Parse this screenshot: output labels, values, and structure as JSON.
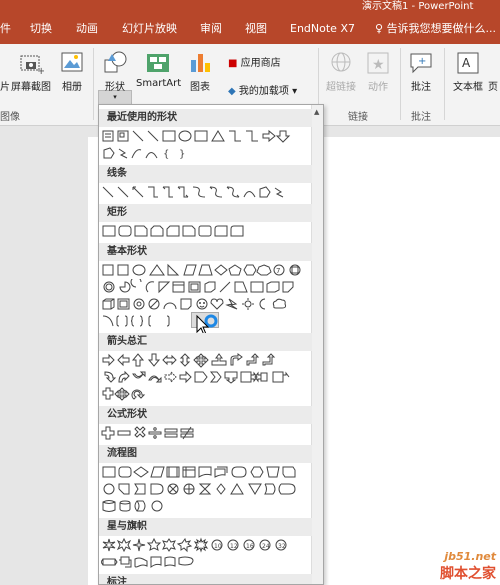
{
  "window": {
    "title": "演示文稿1 - PowerPoint"
  },
  "tabs": [
    "件",
    "切换",
    "动画",
    "幻灯片放映",
    "审阅",
    "视图",
    "EndNote X7",
    "告诉我您想要做什么..."
  ],
  "ribbon": {
    "screenshot": "屏幕截图",
    "album": "相册",
    "shapes": "形状",
    "smartart": "SmartArt",
    "chart": "图表",
    "store": "应用商店",
    "my_addins": "我的加载项",
    "hyperlink": "超链接",
    "action": "动作",
    "comment": "批注",
    "textbox": "文本框",
    "header_footer": "页",
    "group_images": "图像",
    "group_links": "链接",
    "group_comments": "批注",
    "left_cut": "片"
  },
  "dropdown": {
    "sections": [
      "最近使用的形状",
      "线条",
      "矩形",
      "基本形状",
      "箭头总汇",
      "公式形状",
      "流程图",
      "星与旗帜",
      "标注"
    ]
  },
  "watermark": {
    "site": "jb51.net",
    "brand": "脚本之家"
  },
  "colors": {
    "ribbon_accent": "#b7472a",
    "cursor_ring": "#1e88e5"
  }
}
